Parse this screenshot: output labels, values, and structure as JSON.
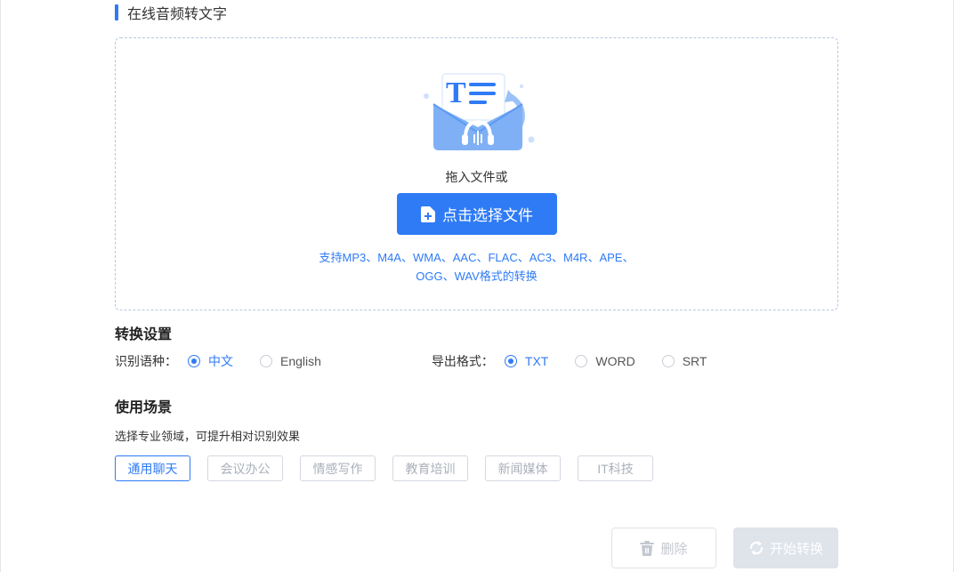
{
  "header": {
    "title": "在线音频转文字"
  },
  "upload": {
    "drop_hint": "拖入文件或",
    "select_button": "点击选择文件",
    "formats_line1": "支持MP3、M4A、WMA、AAC、FLAC、AC3、M4R、APE、",
    "formats_line2": "OGG、WAV格式的转换",
    "illustration_icon": "audio-to-text-envelope-icon"
  },
  "settings": {
    "title": "转换设置",
    "language_label": "识别语种：",
    "languages": [
      {
        "label": "中文",
        "checked": true
      },
      {
        "label": "English",
        "checked": false
      }
    ],
    "export_label": "导出格式：",
    "formats": [
      {
        "label": "TXT",
        "checked": true
      },
      {
        "label": "WORD",
        "checked": false
      },
      {
        "label": "SRT",
        "checked": false
      }
    ]
  },
  "scenes": {
    "title": "使用场景",
    "desc": "选择专业领域，可提升相对识别效果",
    "items": [
      {
        "label": "通用聊天",
        "active": true
      },
      {
        "label": "会议办公",
        "active": false
      },
      {
        "label": "情感写作",
        "active": false
      },
      {
        "label": "教育培训",
        "active": false
      },
      {
        "label": "新闻媒体",
        "active": false
      },
      {
        "label": "IT科技",
        "active": false
      }
    ]
  },
  "actions": {
    "delete_label": "删除",
    "start_label": "开始转换"
  },
  "colors": {
    "accent": "#2f7bf5",
    "disabled": "#dfe3ea"
  }
}
